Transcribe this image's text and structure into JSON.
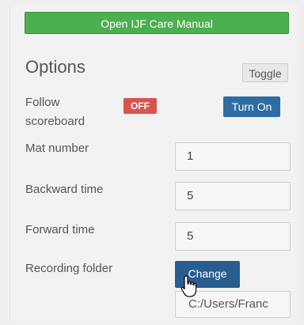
{
  "manual_button_label": "Open IJF Care Manual",
  "options": {
    "title": "Options",
    "toggle_label": "Toggle"
  },
  "follow_scoreboard": {
    "label": "Follow scoreboard",
    "status": "OFF",
    "turn_on_label": "Turn On"
  },
  "mat_number": {
    "label": "Mat number",
    "value": "1"
  },
  "backward_time": {
    "label": "Backward time",
    "value": "5"
  },
  "forward_time": {
    "label": "Forward time",
    "value": "5"
  },
  "recording_folder": {
    "label": "Recording folder",
    "change_label": "Change",
    "path": "C:/Users/Franc"
  },
  "colors": {
    "manual_button": "#4caf50",
    "off_badge": "#d9534f",
    "primary_button": "#2e6da4"
  },
  "icons": {
    "cursor": "hand-pointer-icon"
  }
}
